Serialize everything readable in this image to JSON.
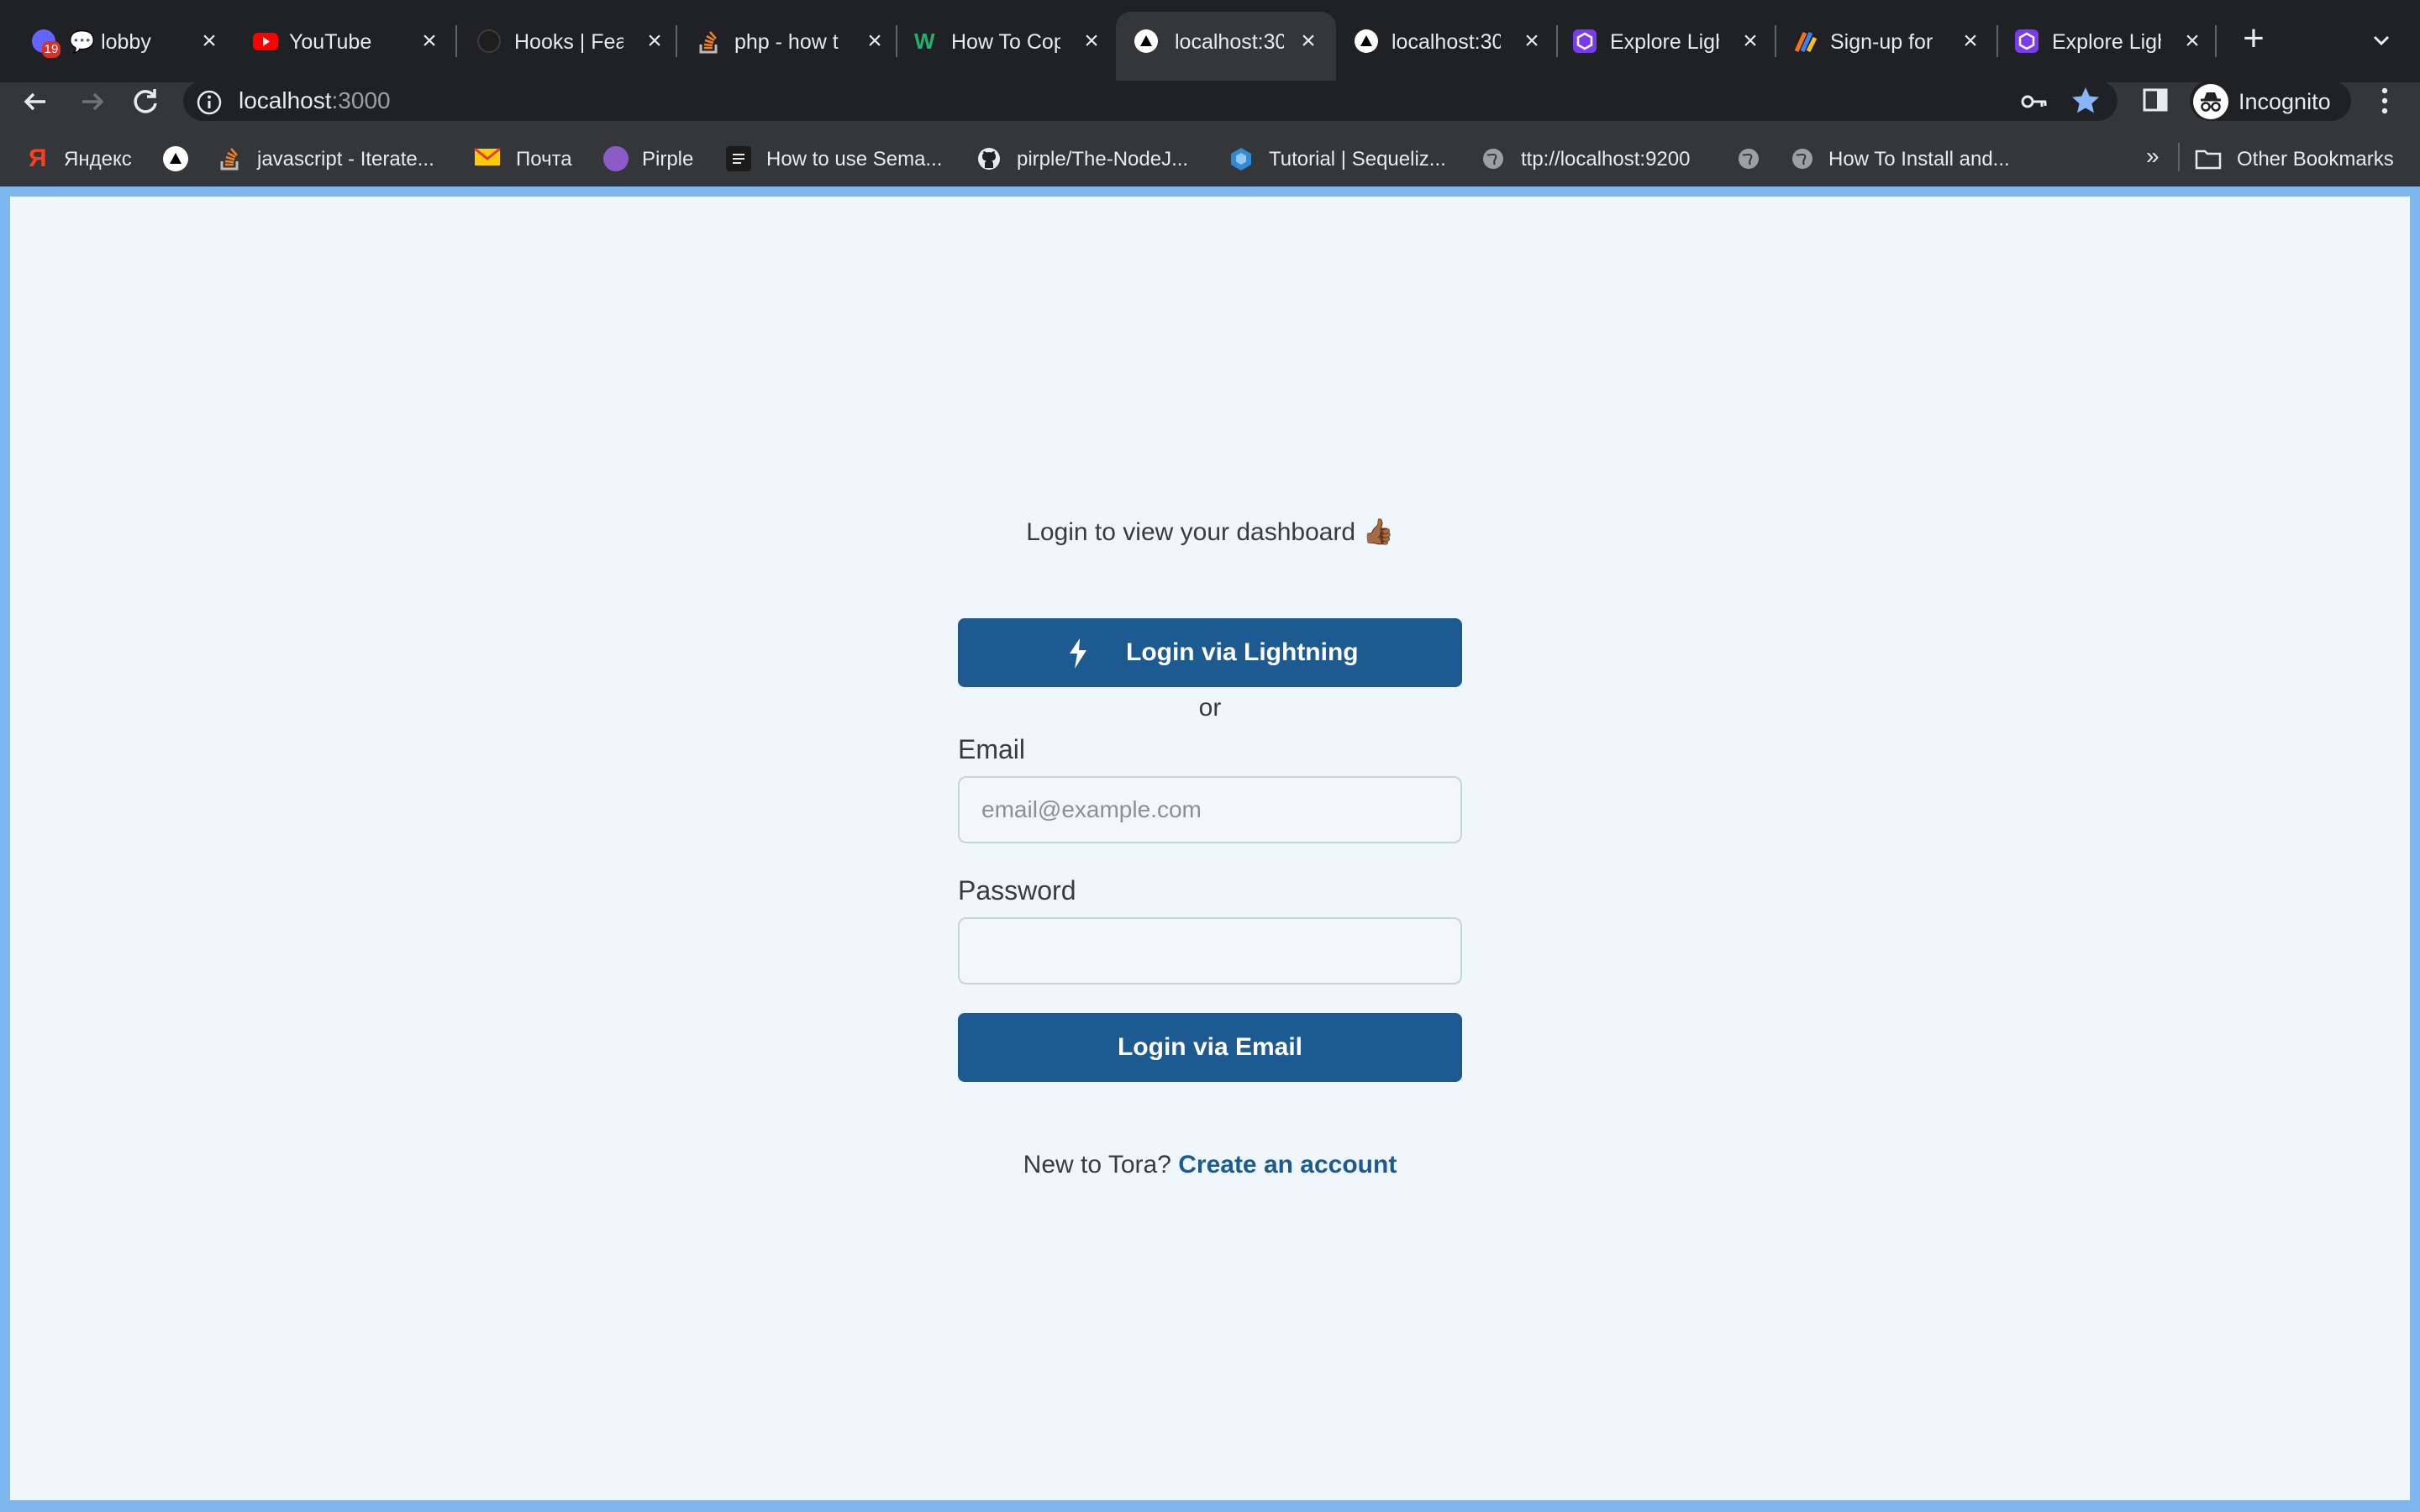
{
  "tabs": [
    {
      "title": "💬 lobby",
      "badge": "19",
      "icon": "mastodon-icon"
    },
    {
      "title": "YouTube",
      "icon": "youtube-icon"
    },
    {
      "title": "Hooks | Fea",
      "icon": "nextjs-icon"
    },
    {
      "title": "php - how t",
      "icon": "stackoverflow-icon"
    },
    {
      "title": "How To Cop",
      "icon": "w-icon"
    },
    {
      "title": "localhost:30",
      "icon": "vercel-icon",
      "active": true
    },
    {
      "title": "localhost:30",
      "icon": "vercel-icon"
    },
    {
      "title": "Explore Ligh",
      "icon": "hexagon-icon"
    },
    {
      "title": "Sign-up for",
      "icon": "sign-up-icon"
    },
    {
      "title": "Explore Ligh",
      "icon": "hexagon-icon"
    }
  ],
  "toolbar": {
    "url_host": "localhost",
    "url_port": ":3000",
    "profile_label": "Incognito"
  },
  "bookmarks": [
    {
      "label": "Яндекс",
      "icon": "yandex-icon"
    },
    {
      "label": "",
      "icon": "vercel-icon"
    },
    {
      "label": "javascript - Iterate...",
      "icon": "stackoverflow-icon"
    },
    {
      "label": "Почта",
      "icon": "mail-icon"
    },
    {
      "label": "Pirple",
      "icon": "pirple-icon"
    },
    {
      "label": "How to use Sema...",
      "icon": "doc-icon"
    },
    {
      "label": "pirple/The-NodeJ...",
      "icon": "github-icon"
    },
    {
      "label": "Tutorial | Sequeliz...",
      "icon": "sequelize-icon"
    },
    {
      "label": "ttp://localhost:9200",
      "icon": "globe-icon"
    },
    {
      "label": "",
      "icon": "globe-icon"
    },
    {
      "label": "How To Install and...",
      "icon": "globe-icon"
    },
    {
      "label": "Other Bookmarks",
      "icon": "folder-icon"
    }
  ],
  "page": {
    "tagline": "Login to view your dashboard 👍🏾",
    "lightning_button": "Login via Lightning",
    "or": "or",
    "email_label": "Email",
    "email_placeholder": "email@example.com",
    "password_label": "Password",
    "email_button": "Login via Email",
    "signup_prompt": "New to Tora?",
    "signup_link": "Create an account"
  },
  "colors": {
    "primary": "#1d5a92",
    "page_background": "#eff7fd",
    "page_border": "#7eb6f0",
    "browser_dark": "#202124",
    "toolbar": "#35363a",
    "bookmark_star": "#8ab4f8"
  }
}
